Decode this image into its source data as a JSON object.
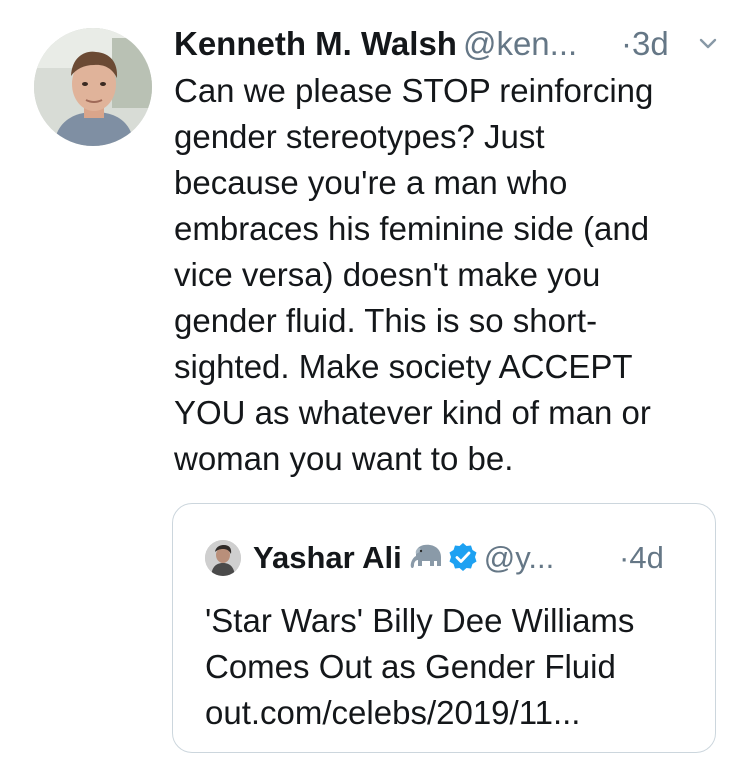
{
  "tweet": {
    "author_name": "Kenneth M. Walsh",
    "handle": "@ken...",
    "time": "·3d",
    "text": "Can we please STOP reinforcing\ngender stereotypes? Just\nbecause you're a man who\nembraces his feminine side (and\nvice versa) doesn't make you\ngender fluid. This is so short-\nsighted. Make society ACCEPT\nYOU as whatever kind of man or\nwoman you want to be.",
    "avatar_icon": "profile-photo",
    "menu_icon": "chevron-down-icon"
  },
  "quoted_tweet": {
    "author_name": "Yashar Ali",
    "emoji": "elephant-emoji",
    "verified_icon": "verified-badge-icon",
    "handle": "@y...",
    "time": "·4d",
    "text": "'Star Wars' Billy Dee Williams\nComes Out as Gender Fluid\nout.com/celebs/2019/11..."
  },
  "colors": {
    "text": "#14171a",
    "secondary": "#657786",
    "verified": "#1da1f2",
    "border": "#ccd6dd"
  }
}
